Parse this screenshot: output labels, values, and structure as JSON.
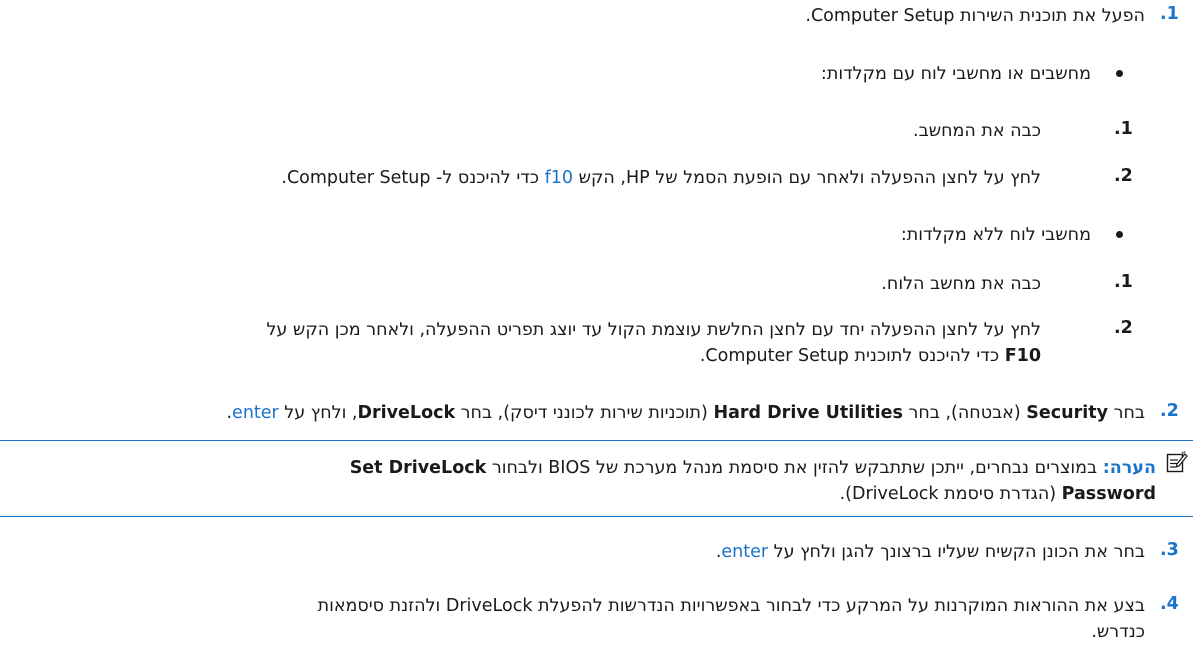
{
  "steps": {
    "s1": {
      "num": "1.",
      "text": "הפעל את תוכנית השירות Computer Setup.",
      "b1": {
        "text": "מחשבים או מחשבי לוח עם מקלדות:",
        "i1_num": "1.",
        "i1_text": "כבה את המחשב.",
        "i2_num": "2.",
        "i2_pre": "לחץ על לחצן ההפעלה ולאחר עם הופעת הסמל של HP, הקש ",
        "i2_key": "f10",
        "i2_post": " כדי להיכנס ל- Computer Setup."
      },
      "b2": {
        "text": "מחשבי לוח ללא מקלדות:",
        "i1_num": "1.",
        "i1_text": "כבה את מחשב הלוח.",
        "i2_num": "2.",
        "i2_line1": "לחץ על לחצן ההפעלה יחד עם לחצן החלשת עוצמת הקול עד יוצג תפריט ההפעלה, ולאחר מכן הקש על",
        "i2_key": "F10",
        "i2_line2": " כדי להיכנס לתוכנית Computer Setup."
      }
    },
    "s2": {
      "num": "2.",
      "p1": "בחר ",
      "b1": "Security",
      "p2": " (אבטחה), בחר ",
      "b2": "Hard Drive Utilities",
      "p3": " (תוכניות שירות לכונני דיסק), בחר ",
      "b3": "DriveLock",
      "p4": ", ולחץ על ",
      "key": "enter",
      "p5": "."
    },
    "note": {
      "label": "הערה:",
      "l1_text": " במוצרים נבחרים, ייתכן שתתבקש להזין את סיסמת מנהל מערכת של BIOS ולבחור ",
      "l1_bold": "Set DriveLock",
      "l2_bold": "Password",
      "l2_text": " (הגדרת סיסמת DriveLock)."
    },
    "s3": {
      "num": "3.",
      "pre": "בחר את הכונן הקשיח שעליו ברצונך להגן ולחץ על ",
      "key": "enter",
      "post": "."
    },
    "s4": {
      "num": "4.",
      "line1": "בצע את ההוראות המוקרנות על המרקע כדי לבחור באפשרויות הנדרשות להפעלת DriveLock ולהזנת סיסמאות",
      "line2": "כנדרש."
    }
  },
  "colors": {
    "accent": "#1a73c8",
    "text": "#1a1a1a"
  },
  "icons": {
    "note": "note-pencil-icon"
  }
}
